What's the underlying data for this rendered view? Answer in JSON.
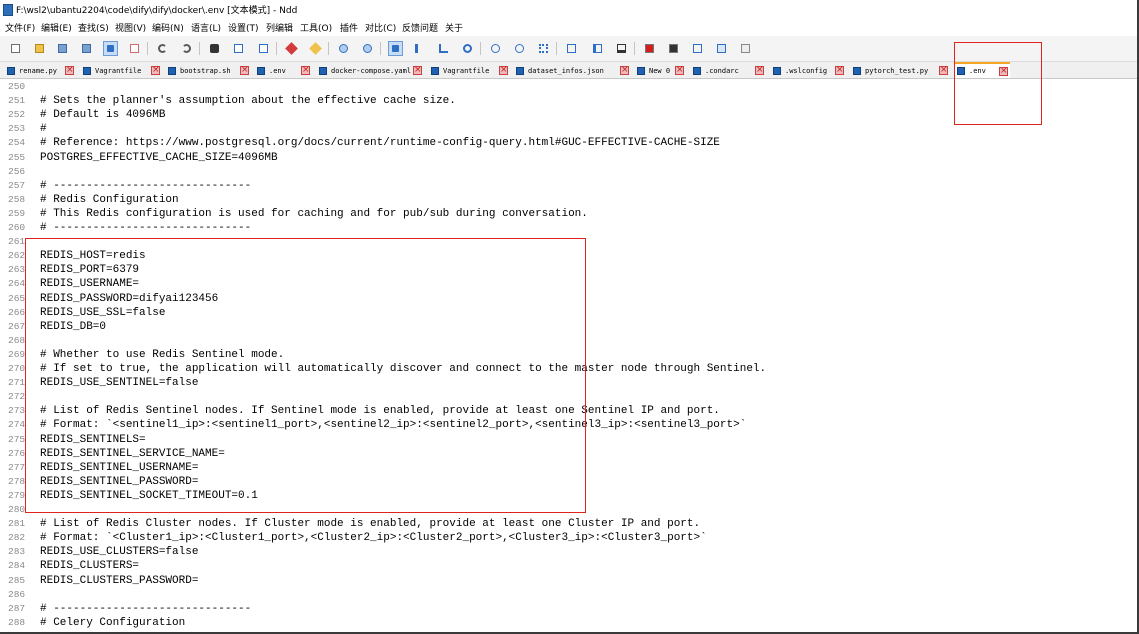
{
  "window": {
    "title": "F:\\wsl2\\ubantu2204\\code\\dify\\dify\\docker\\.env [文本模式] - Ndd"
  },
  "menu": [
    "文件(F)",
    "编辑(E)",
    "查找(S)",
    "视图(V)",
    "编码(N)",
    "语言(L)",
    "设置(T)",
    "列编辑",
    "工具(O)",
    "插件",
    "对比(C)",
    "反馈问题",
    "关于"
  ],
  "toolbar": {
    "icons": [
      "new-file-icon",
      "open-folder-icon",
      "save-icon",
      "save-all-icon",
      "close-icon",
      "close-all-icon",
      "undo-icon",
      "redo-icon",
      "find-icon",
      "replace-icon",
      "find-in-files-icon",
      "highlight-icon",
      "clear-highlight-icon",
      "zoom-in-icon",
      "zoom-out-icon",
      "word-wrap-icon",
      "show-symbols-icon",
      "indent-guide-icon",
      "focus-icon",
      "prev-icon",
      "next-icon",
      "binary-icon",
      "compare-file-icon",
      "compare-folder-icon",
      "monitor-icon",
      "record-macro-icon",
      "stop-macro-icon",
      "play-macro-icon",
      "save-macro-icon",
      "multi-doc-icon"
    ]
  },
  "tabs": [
    {
      "label": "rename.py",
      "active": false
    },
    {
      "label": "Vagrantfile",
      "active": false
    },
    {
      "label": "bootstrap.sh",
      "active": false
    },
    {
      "label": ".env",
      "active": false
    },
    {
      "label": "docker-compose.yaml",
      "active": false
    },
    {
      "label": "Vagrantfile",
      "active": false
    },
    {
      "label": "dataset_infos.json",
      "active": false
    },
    {
      "label": "New 0",
      "active": false
    },
    {
      "label": ".condarc",
      "active": false
    },
    {
      "label": ".wslconfig",
      "active": false
    },
    {
      "label": "pytorch_test.py",
      "active": false
    },
    {
      "label": ".env",
      "active": true
    }
  ],
  "lines": [
    {
      "n": "250",
      "t": ""
    },
    {
      "n": "251",
      "t": "# Sets the planner's assumption about the effective cache size."
    },
    {
      "n": "252",
      "t": "# Default is 4096MB"
    },
    {
      "n": "253",
      "t": "#"
    },
    {
      "n": "254",
      "t": "# Reference: https://www.postgresql.org/docs/current/runtime-config-query.html#GUC-EFFECTIVE-CACHE-SIZE"
    },
    {
      "n": "255",
      "t": "POSTGRES_EFFECTIVE_CACHE_SIZE=4096MB"
    },
    {
      "n": "256",
      "t": ""
    },
    {
      "n": "257",
      "t": "# ------------------------------"
    },
    {
      "n": "258",
      "t": "# Redis Configuration"
    },
    {
      "n": "259",
      "t": "# This Redis configuration is used for caching and for pub/sub during conversation."
    },
    {
      "n": "260",
      "t": "# ------------------------------"
    },
    {
      "n": "261",
      "t": ""
    },
    {
      "n": "262",
      "t": "REDIS_HOST=redis"
    },
    {
      "n": "263",
      "t": "REDIS_PORT=6379"
    },
    {
      "n": "264",
      "t": "REDIS_USERNAME="
    },
    {
      "n": "265",
      "t": "REDIS_PASSWORD=difyai123456"
    },
    {
      "n": "266",
      "t": "REDIS_USE_SSL=false"
    },
    {
      "n": "267",
      "t": "REDIS_DB=0"
    },
    {
      "n": "268",
      "t": ""
    },
    {
      "n": "269",
      "t": "# Whether to use Redis Sentinel mode."
    },
    {
      "n": "270",
      "t": "# If set to true, the application will automatically discover and connect to the master node through Sentinel."
    },
    {
      "n": "271",
      "t": "REDIS_USE_SENTINEL=false"
    },
    {
      "n": "272",
      "t": ""
    },
    {
      "n": "273",
      "t": "# List of Redis Sentinel nodes. If Sentinel mode is enabled, provide at least one Sentinel IP and port."
    },
    {
      "n": "274",
      "t": "# Format: `<sentinel1_ip>:<sentinel1_port>,<sentinel2_ip>:<sentinel2_port>,<sentinel3_ip>:<sentinel3_port>`"
    },
    {
      "n": "275",
      "t": "REDIS_SENTINELS="
    },
    {
      "n": "276",
      "t": "REDIS_SENTINEL_SERVICE_NAME="
    },
    {
      "n": "277",
      "t": "REDIS_SENTINEL_USERNAME="
    },
    {
      "n": "278",
      "t": "REDIS_SENTINEL_PASSWORD="
    },
    {
      "n": "279",
      "t": "REDIS_SENTINEL_SOCKET_TIMEOUT=0.1"
    },
    {
      "n": "280",
      "t": ""
    },
    {
      "n": "281",
      "t": "# List of Redis Cluster nodes. If Cluster mode is enabled, provide at least one Cluster IP and port."
    },
    {
      "n": "282",
      "t": "# Format: `<Cluster1_ip>:<Cluster1_port>,<Cluster2_ip>:<Cluster2_port>,<Cluster3_ip>:<Cluster3_port>`"
    },
    {
      "n": "283",
      "t": "REDIS_USE_CLUSTERS=false"
    },
    {
      "n": "284",
      "t": "REDIS_CLUSTERS="
    },
    {
      "n": "285",
      "t": "REDIS_CLUSTERS_PASSWORD="
    },
    {
      "n": "286",
      "t": ""
    },
    {
      "n": "287",
      "t": "# ------------------------------"
    },
    {
      "n": "288",
      "t": "# Celery Configuration"
    }
  ],
  "colors": {
    "annotation": "#e0231e",
    "active_tab_accent": "#f5a623",
    "file_icon": "#1f62b4",
    "close_icon": "#cc3d3d"
  }
}
